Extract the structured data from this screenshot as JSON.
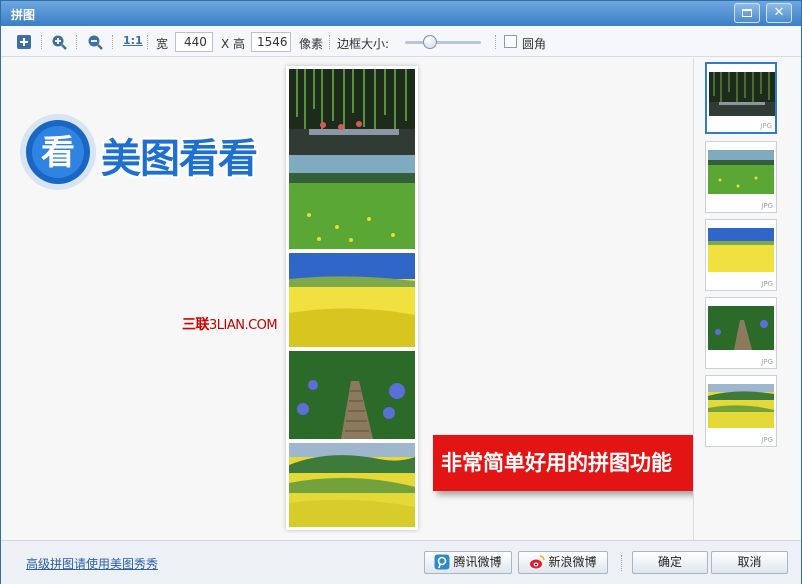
{
  "window": {
    "title": "拼图"
  },
  "toolbar": {
    "ratio_label": "1:1",
    "width_label": "宽",
    "width_value": "440",
    "x_label": "X 高",
    "height_value": "1546",
    "pixel_label": "像素",
    "border_label": "边框大小:",
    "round_label": "圆角",
    "border_size_fraction": 0.33,
    "round_checked": false
  },
  "canvas": {
    "logo_text": "美图看看",
    "logo_badge": "看",
    "watermark_cn": "三联",
    "watermark_latin": "3LIAN.COM",
    "banner_text": "非常简单好用的拼图功能"
  },
  "thumbnails": [
    {
      "tag": "JPG",
      "active": true
    },
    {
      "tag": "JPG",
      "active": false
    },
    {
      "tag": "JPG",
      "active": false
    },
    {
      "tag": "JPG",
      "active": false
    },
    {
      "tag": "JPG",
      "active": false
    }
  ],
  "footer": {
    "advanced_link": "高级拼图请使用美图秀秀",
    "tencent_label": "腾讯微博",
    "sina_label": "新浪微博",
    "ok_label": "确定",
    "cancel_label": "取消"
  },
  "colors": {
    "accent": "#3b7fc7",
    "banner": "#e31414",
    "watermark": "#d40000",
    "link": "#2a5ea8"
  }
}
